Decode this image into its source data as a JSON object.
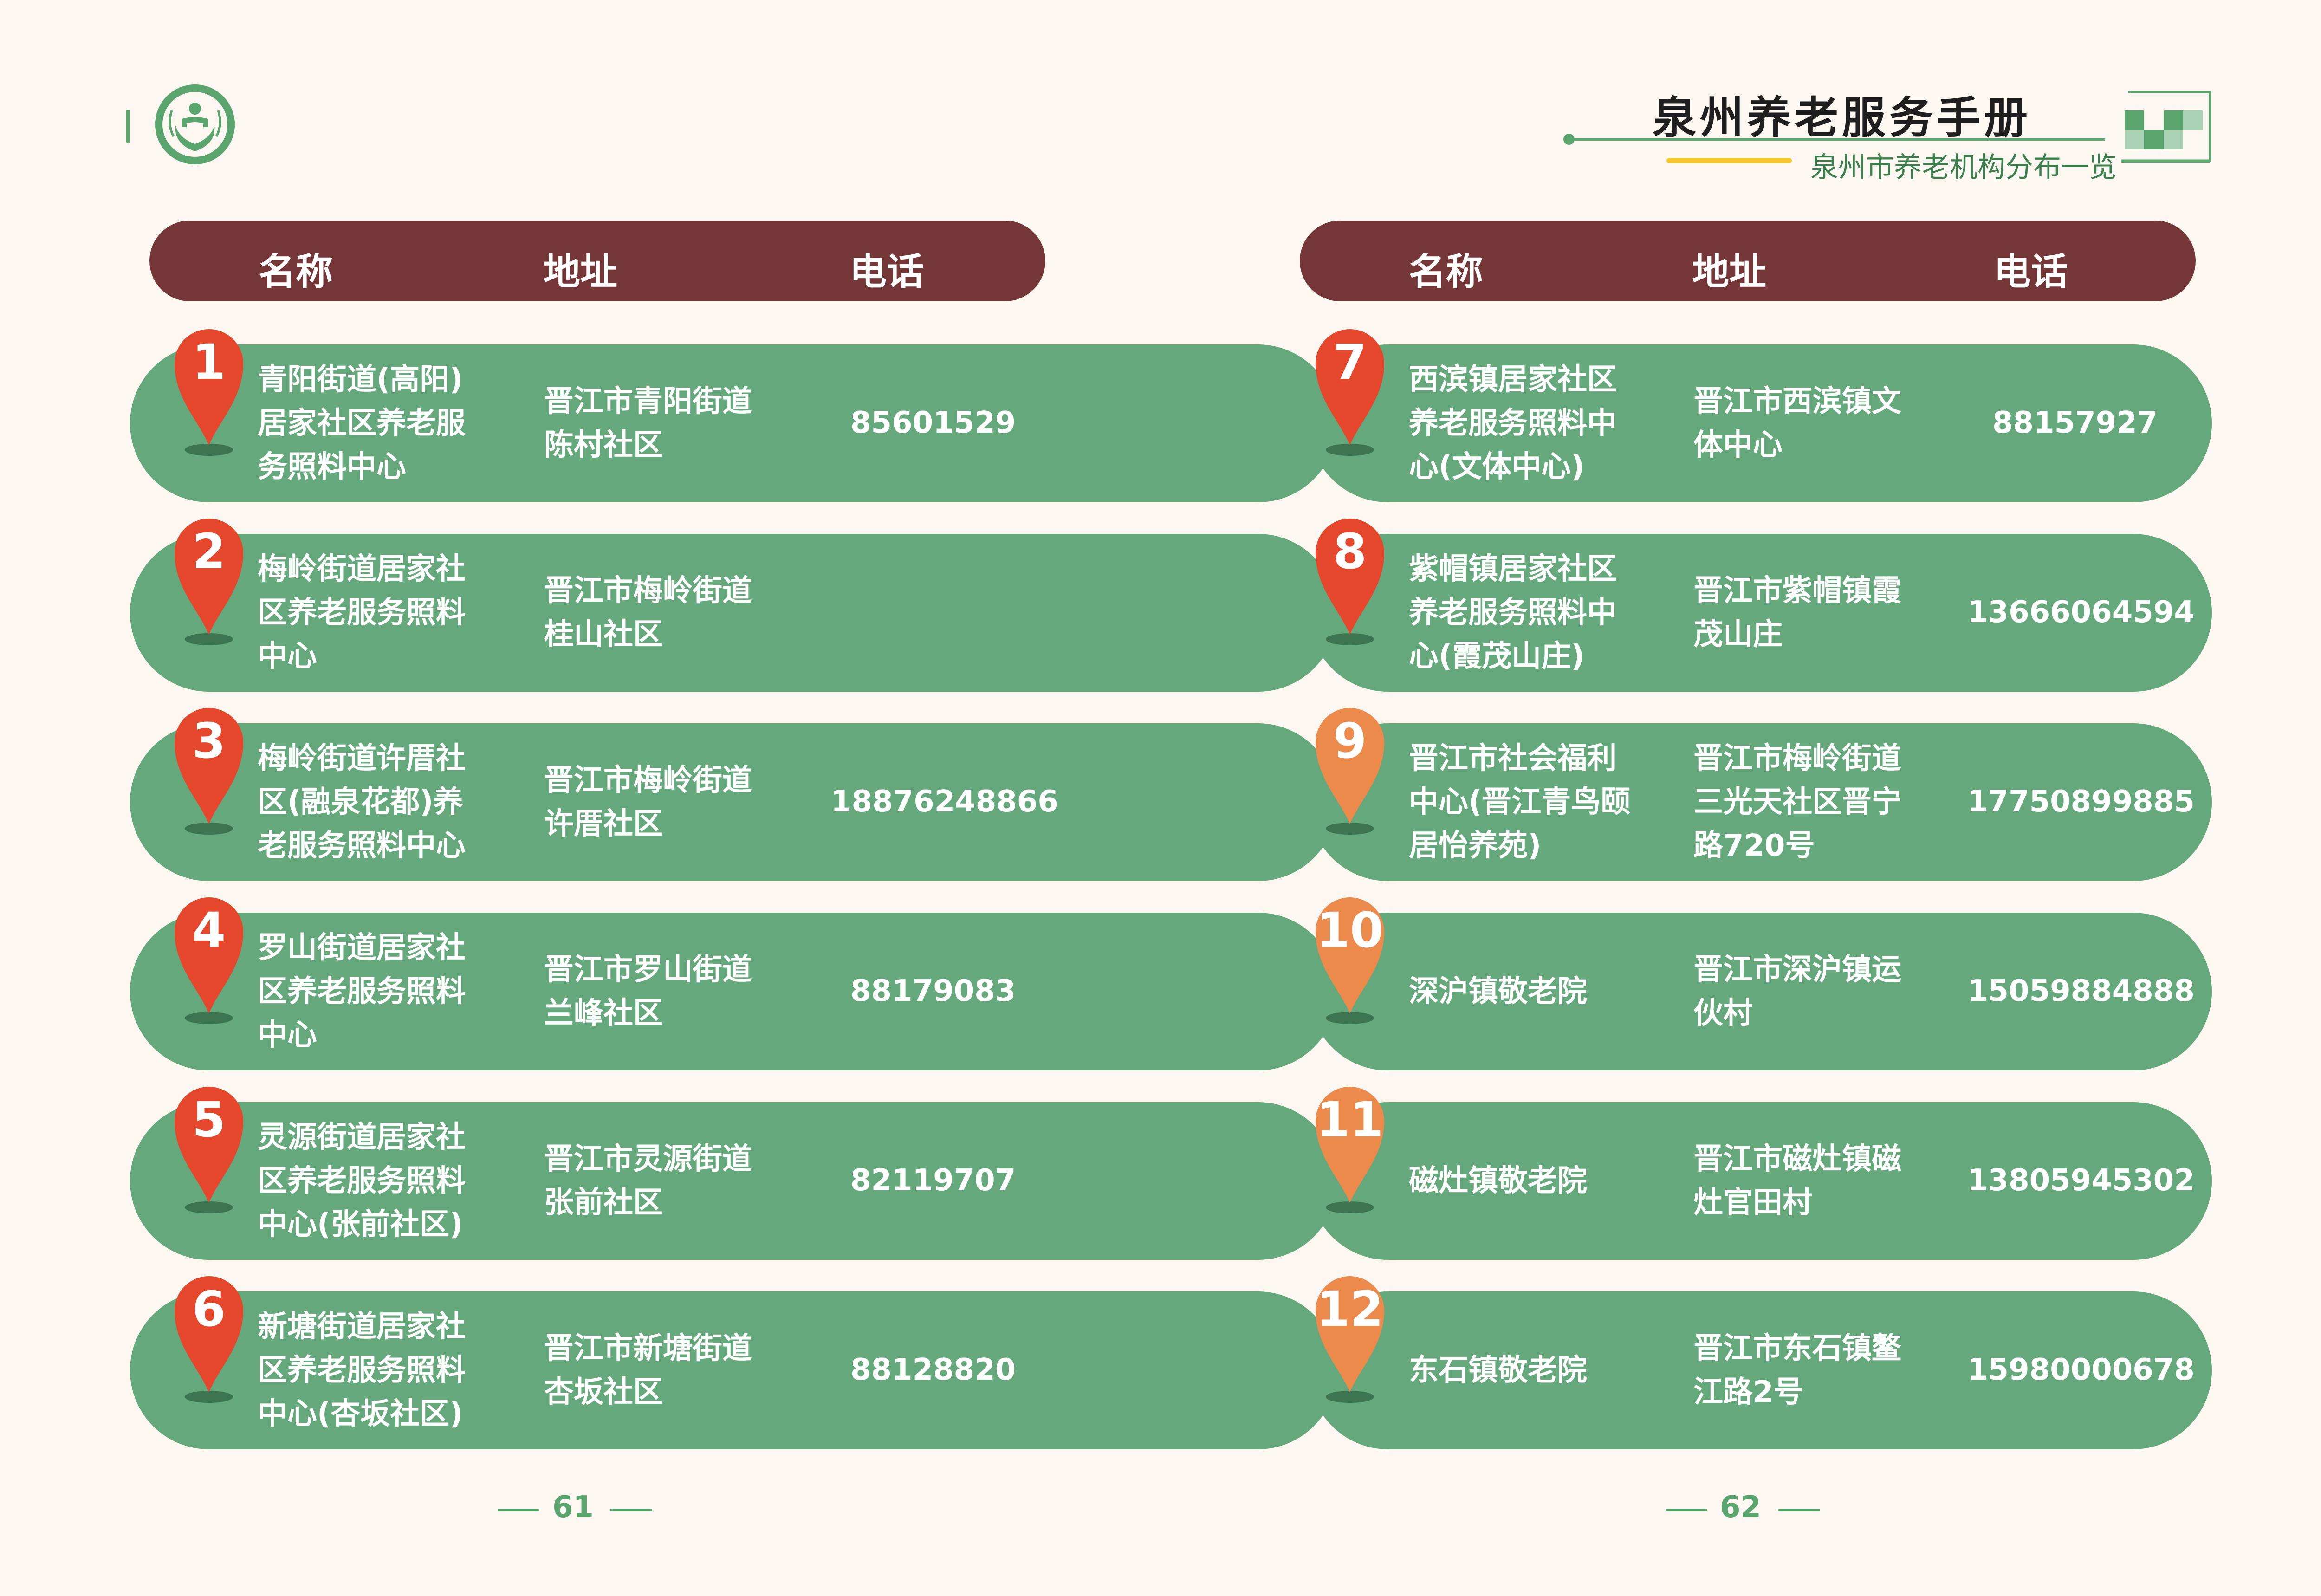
{
  "header": {
    "title": "泉州养老服务手册",
    "subtitle": "泉州市养老机构分布一览"
  },
  "columns": {
    "name": "名称",
    "address": "地址",
    "phone": "电话"
  },
  "left": [
    {
      "num": "1",
      "name": "青阳街道(高阳)\n居家社区养老服\n务照料中心",
      "address": "晋江市青阳街道\n陈村社区",
      "phone": "85601529"
    },
    {
      "num": "2",
      "name": "梅岭街道居家社\n区养老服务照料\n中心",
      "address": "晋江市梅岭街道\n桂山社区",
      "phone": ""
    },
    {
      "num": "3",
      "name": "梅岭街道许厝社\n区(融泉花都)养\n老服务照料中心",
      "address": "晋江市梅岭街道\n许厝社区",
      "phone": "18876248866"
    },
    {
      "num": "4",
      "name": "罗山街道居家社\n区养老服务照料\n中心",
      "address": "晋江市罗山街道\n兰峰社区",
      "phone": "88179083"
    },
    {
      "num": "5",
      "name": "灵源街道居家社\n区养老服务照料\n中心(张前社区)",
      "address": "晋江市灵源街道\n张前社区",
      "phone": "82119707"
    },
    {
      "num": "6",
      "name": "新塘街道居家社\n区养老服务照料\n中心(杏坂社区)",
      "address": "晋江市新塘街道\n杏坂社区",
      "phone": "88128820"
    }
  ],
  "right": [
    {
      "num": "7",
      "name": "西滨镇居家社区\n养老服务照料中\n心(文体中心)",
      "address": "晋江市西滨镇文\n体中心",
      "phone": "88157927"
    },
    {
      "num": "8",
      "name": "紫帽镇居家社区\n养老服务照料中\n心(霞茂山庄)",
      "address": "晋江市紫帽镇霞\n茂山庄",
      "phone": "13666064594"
    },
    {
      "num": "9",
      "name": "晋江市社会福利\n中心(晋江青鸟颐\n居怡养苑)",
      "address": "晋江市梅岭街道\n三光天社区晋宁\n路720号",
      "phone": "17750899885"
    },
    {
      "num": "10",
      "name": "深沪镇敬老院",
      "address": "晋江市深沪镇运\n伙村",
      "phone": "15059884888"
    },
    {
      "num": "11",
      "name": "磁灶镇敬老院",
      "address": "晋江市磁灶镇磁\n灶官田村",
      "phone": "13805945302"
    },
    {
      "num": "12",
      "name": "东石镇敬老院",
      "address": "晋江市东石镇鳌\n江路2号",
      "phone": "15980000678"
    }
  ],
  "pages": {
    "left": "61",
    "right": "62"
  },
  "colors": {
    "background": "#fcf8f1",
    "header_bar": "#743637",
    "row": "#65a87c",
    "pin_red": "#e4472b",
    "pin_orange": "#ec8a4b",
    "accent_green": "#5aa46e",
    "accent_yellow": "#f4c52c"
  },
  "icons": {
    "logo": "elderly-care-logo-icon",
    "pin": "map-pin-icon",
    "corner": "checker-deco-icon"
  }
}
